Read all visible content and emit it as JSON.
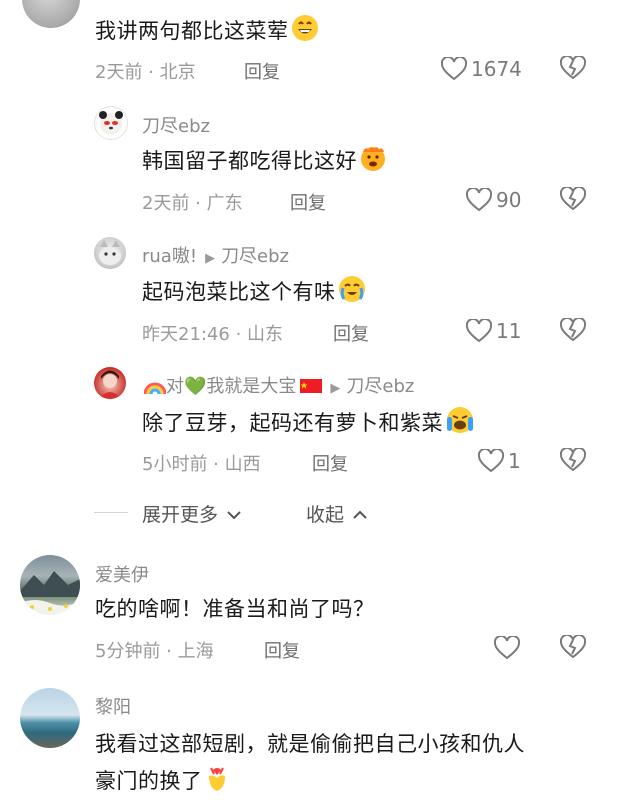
{
  "comments": [
    {
      "text": "我讲两句都比这菜荤",
      "time_location": "2天前 · 北京",
      "reply_label": "回复",
      "likes": "1674"
    },
    {
      "author": "刀尽ebz",
      "text": "韩国留子都吃得比这好",
      "time_location": "2天前 · 广东",
      "reply_label": "回复",
      "likes": "90"
    },
    {
      "author": "rua嗷!",
      "reply_to": "刀尽ebz",
      "text": "起码泡菜比这个有味",
      "time_location": "昨天21:46 · 山东",
      "reply_label": "回复",
      "likes": "11"
    },
    {
      "author": "对💚我就是大宝",
      "reply_to": "刀尽ebz",
      "text": "除了豆芽，起码还有萝卜和紫菜",
      "time_location": "5小时前 · 山西",
      "reply_label": "回复",
      "likes": "1"
    },
    {
      "author": "爱美伊",
      "text": "吃的啥啊！准备当和尚了吗？",
      "time_location": "5分钟前 · 上海",
      "reply_label": "回复",
      "likes": ""
    },
    {
      "author": "黎阳",
      "text_line1": "我看过这部短剧，就是偷偷把自己小孩和仇人",
      "text_line2": "豪门的换了"
    }
  ],
  "thread_controls": {
    "expand_more": "展开更多",
    "collapse": "收起"
  },
  "icons": {
    "like": "heart-outline-icon",
    "dislike": "broken-heart-icon",
    "expand": "chevron-down-icon",
    "collapse": "chevron-up-icon",
    "reply_arrow": "triangle-right-icon"
  },
  "colors": {
    "text": "#1a1a1a",
    "meta": "#9a9a9a",
    "icon": "#7a7a7a"
  }
}
